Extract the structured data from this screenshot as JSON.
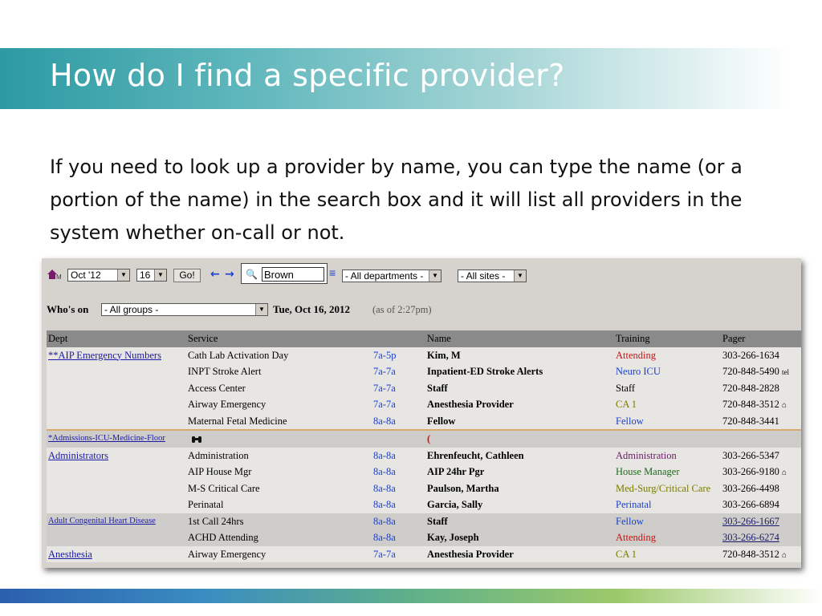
{
  "slide": {
    "title": "How do I find a specific provider?",
    "body": "If you need to look up a provider by name, you can type the name (or a portion of the name) in the search box and it will list all providers in the system whether on-call or not."
  },
  "toolbar": {
    "month_value": "Oct '12",
    "day_value": "16",
    "go_label": "Go!",
    "search_value": "Brown",
    "department_value": "- All departments -",
    "site_value": "- All sites -",
    "whos_on_label": "Who's on",
    "group_value": "- All groups -",
    "date_label": "Tue, Oct 16, 2012",
    "as_of_label": "(as of 2:27pm)"
  },
  "table": {
    "headers": [
      "Dept",
      "Service",
      "",
      "Name",
      "Training",
      "Pager"
    ],
    "rows": [
      {
        "dept": "**AIP Emergency Numbers",
        "service": "Cath Lab Activation Day",
        "time": "7a-5p",
        "name": "Kim, M",
        "training": "Attending",
        "pager": "303-266-1634"
      },
      {
        "dept": "",
        "service": "INPT Stroke Alert",
        "time": "7a-7a",
        "name": "Inpatient-ED Stroke Alerts",
        "training": "Neuro ICU",
        "pager": "720-848-5490",
        "pager_suffix": "tel"
      },
      {
        "dept": "",
        "service": "Access Center",
        "time": "7a-7a",
        "name": "Staff",
        "training": "Staff",
        "pager": "720-848-2828"
      },
      {
        "dept": "",
        "service": "Airway Emergency",
        "time": "7a-7a",
        "name": "Anesthesia Provider",
        "training": "CA 1",
        "pager": "720-848-3512"
      },
      {
        "dept": "",
        "service": "Maternal Fetal Medicine",
        "time": "8a-8a",
        "name": "Fellow",
        "training": "Fellow",
        "pager": "720-848-3441"
      },
      {
        "dept": "*Admissions-ICU-Medicine-Floor",
        "service": "",
        "time": "",
        "name": "(",
        "training": "",
        "pager": ""
      },
      {
        "dept": "Administrators",
        "service": "Administration",
        "time": "8a-8a",
        "name": "Ehrenfeucht, Cathleen",
        "training": "Administration",
        "pager": "303-266-5347"
      },
      {
        "dept": "",
        "service": "AIP House Mgr",
        "time": "8a-8a",
        "name": "AIP 24hr Pgr",
        "training": "House Manager",
        "pager": "303-266-9180"
      },
      {
        "dept": "",
        "service": "M-S Critical Care",
        "time": "8a-8a",
        "name": "Paulson, Martha",
        "training": "Med-Surg/Critical Care",
        "pager": "303-266-4498"
      },
      {
        "dept": "",
        "service": "Perinatal",
        "time": "8a-8a",
        "name": "Garcia, Sally",
        "training": "Perinatal",
        "pager": "303-266-6894"
      },
      {
        "dept": "Adult Congenital Heart Disease",
        "service": "1st Call 24hrs",
        "time": "8a-8a",
        "name": "Staff",
        "training": "Fellow",
        "pager": "303-266-1667"
      },
      {
        "dept": "",
        "service": "ACHD Attending",
        "time": "8a-8a",
        "name": "Kay, Joseph",
        "training": "Attending",
        "pager": "303-266-6274"
      },
      {
        "dept": "Anesthesia",
        "service": "Airway Emergency",
        "time": "7a-7a",
        "name": "Anesthesia Provider",
        "training": "CA 1",
        "pager": "720-848-3512"
      }
    ]
  },
  "colors": {
    "title_band_start": "#2d9aa3",
    "link_blue": "#1a1aa6",
    "attending_red": "#cc1111",
    "fellow_blue": "#1a3fcc",
    "house_green": "#1c6a1c",
    "header_gray": "#8a8a8a"
  },
  "icons": [
    "home-icon",
    "magnifier-icon",
    "list-icon",
    "binoculars-icon",
    "prev-arrow-icon",
    "next-arrow-icon",
    "house-pager-icon"
  ]
}
